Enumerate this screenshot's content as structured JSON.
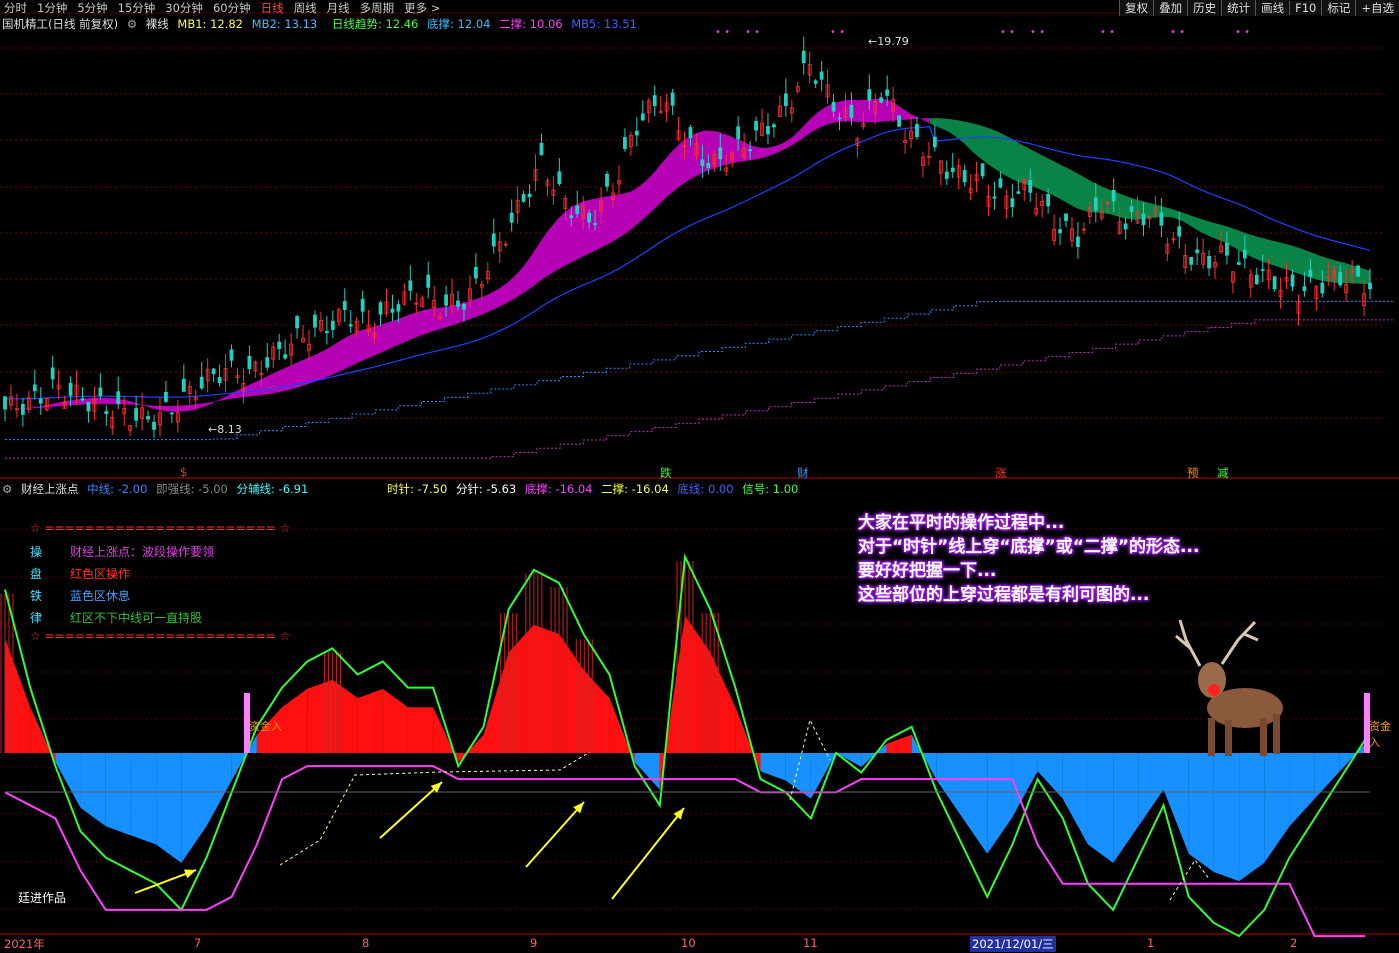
{
  "topbar": {
    "tabs": [
      "分时",
      "1分钟",
      "5分钟",
      "15分钟",
      "30分钟",
      "60分钟",
      "日线",
      "周线",
      "月线",
      "多周期",
      "更多 >"
    ],
    "active_tab": "日线",
    "tools": [
      "复权",
      "叠加",
      "历史",
      "统计",
      "画线",
      "F10",
      "标记",
      "+自选"
    ]
  },
  "main_legend": {
    "name": "国机精工(日线 前复权)",
    "indicator": "裸线",
    "mb1": "MB1: 12.82",
    "mb2": "MB2: 13.13",
    "trend": "日线趋势: 12.46",
    "support": "底撑: 12.04",
    "support2": "二撑: 10.06",
    "mb5": "MB5: 13.51"
  },
  "markers": [
    {
      "text": "$",
      "color": "#ff3030"
    },
    {
      "text": "跌",
      "color": "#30ff30"
    },
    {
      "text": "财",
      "color": "#30a0ff"
    },
    {
      "text": "涨",
      "color": "#ff3030"
    },
    {
      "text": "预",
      "color": "#ff9900"
    },
    {
      "text": "减",
      "color": "#30ff30"
    }
  ],
  "sub_legend": {
    "name": "财经上涨点",
    "mid": "中线: -2.00",
    "strong": "即强线: -5.00",
    "aux": "分辅线: -6.91",
    "hour": "时针: -7.50",
    "minute": "分针: -5.63",
    "support": "底撑: -16.04",
    "support2": "二撑: -16.04",
    "bottom": "底线: 0.00",
    "signal": "信号: 1.00"
  },
  "rules": {
    "border": "☆ ======================= ☆",
    "items": [
      {
        "key": "操",
        "text": "财经上涨点：波段操作要领",
        "color": "#e040e0"
      },
      {
        "key": "盘",
        "text": "红色区操作",
        "color": "#ff3030"
      },
      {
        "key": "铁",
        "text": "蓝色区休息",
        "color": "#40a0ff"
      },
      {
        "key": "律",
        "text": "红区不下中线可一直持股",
        "color": "#30c030"
      }
    ]
  },
  "callout": [
    "大家在平时的操作过程中...",
    "对于“时针”线上穿“底撑”或“二撑”的形态...",
    "要好好把握一下...",
    "这些部位的上穿过程都是有利可图的..."
  ],
  "author": "廷进作品",
  "fund_label": "资金入",
  "x_axis": [
    "2021年",
    "7",
    "8",
    "9",
    "10",
    "11",
    "2021/12/01/三",
    "1",
    "2"
  ],
  "chart_data": {
    "type": "candlestick+indicator",
    "price_high": 19.79,
    "price_low": 8.13,
    "close_path": [
      8.5,
      8.7,
      9.2,
      8.9,
      8.6,
      8.3,
      8.13,
      8.6,
      9.3,
      9.8,
      9.6,
      10.2,
      10.8,
      11.1,
      11.6,
      11.2,
      11.9,
      12.3,
      11.8,
      12.1,
      13.4,
      14.9,
      16.5,
      15.2,
      14.6,
      15.8,
      17.9,
      18.6,
      17.2,
      16.4,
      16.9,
      17.5,
      18.2,
      19.79,
      18.4,
      17.6,
      18.9,
      17.4,
      16.8,
      16.1,
      15.9,
      15.3,
      15.7,
      14.6,
      14.1,
      15.3,
      14.6,
      14.9,
      13.9,
      13.3,
      13.5,
      13.0,
      12.7,
      12.3,
      12.6,
      12.8,
      12.5
    ],
    "price_range": [
      7,
      21
    ],
    "indicator_range": [
      -30,
      35
    ],
    "hour_hand": [
      25,
      10,
      -2,
      -12,
      -16,
      -18,
      -20,
      -24,
      -16,
      -6,
      4,
      10,
      14,
      16,
      12,
      14,
      10,
      10,
      -2,
      4,
      22,
      28,
      26,
      18,
      12,
      -2,
      -8,
      30,
      22,
      10,
      -4,
      -6,
      -10,
      0,
      -3,
      2,
      4,
      -6,
      -14,
      -22,
      -14,
      -4,
      -10,
      -20,
      -24,
      -16,
      -8,
      -22,
      -26,
      -28,
      -24,
      -16,
      -10,
      -4,
      2
    ],
    "support_path": [
      -6,
      -8,
      -10,
      -18,
      -24,
      -24,
      -24,
      -24,
      -24,
      -22,
      -14,
      -4,
      -2,
      -2,
      -2,
      -2,
      -2,
      -2,
      -4,
      -4,
      -4,
      -4,
      -4,
      -4,
      -4,
      -4,
      -4,
      -4,
      -4,
      -4,
      -6,
      -6,
      -6,
      -6,
      -4,
      -4,
      -4,
      -4,
      -4,
      -4,
      -4,
      -14,
      -20,
      -20,
      -20,
      -20,
      -20,
      -20,
      -20,
      -20,
      -20,
      -20,
      -28,
      -28,
      -28
    ]
  }
}
